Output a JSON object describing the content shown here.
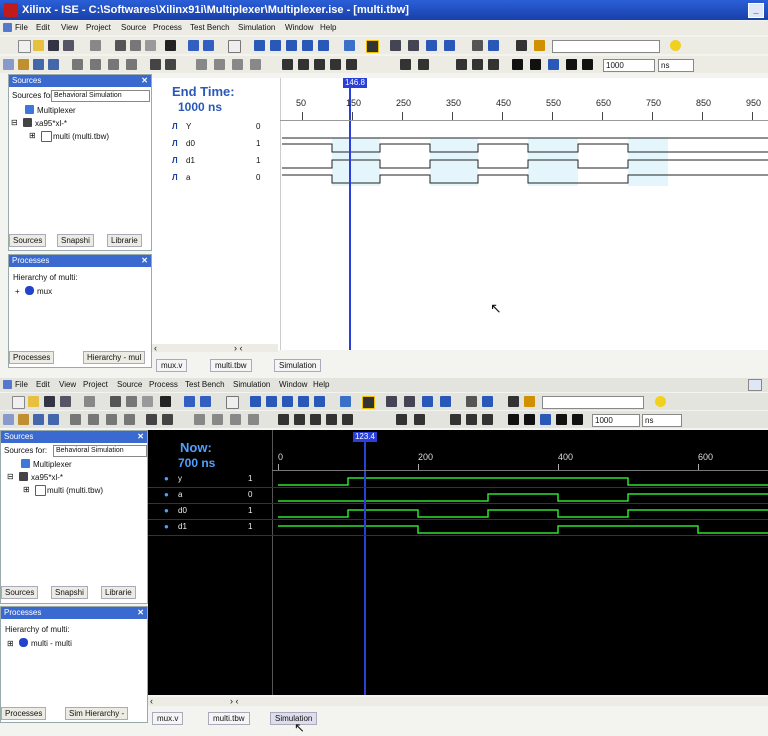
{
  "top_window": {
    "title": "Xilinx - ISE - C:\\Softwares\\Xilinx91i\\Multiplexer\\Multiplexer.ise - [multi.tbw]",
    "menu": [
      "File",
      "Edit",
      "View",
      "Project",
      "Source",
      "Process",
      "Test Bench",
      "Simulation",
      "Window",
      "Help"
    ],
    "controls": {
      "min": "_",
      "max": "□"
    },
    "toolbar": {
      "time_value": "1000",
      "time_unit": "ns"
    },
    "sources_panel": {
      "title": "Sources",
      "sources_for_label": "Sources for:",
      "sources_for_value": "Behavioral Simulation",
      "items": [
        "Multiplexer",
        "xa95*xl-*",
        "multi (multi.tbw)"
      ],
      "tabs": [
        "Sources",
        "Snapshi",
        "Librarie"
      ]
    },
    "processes_panel": {
      "title": "Processes",
      "hierarchy_label": "Hierarchy of multi:",
      "items": [
        "mux"
      ],
      "tabs": [
        "Processes",
        "Hierarchy - mul"
      ]
    },
    "wave": {
      "end_time_label": "End Time:",
      "end_time_value": "1000 ns",
      "cursor_value": "146.8",
      "axis_ticks": [
        "50",
        "150",
        "250",
        "350",
        "450",
        "550",
        "650",
        "750",
        "850",
        "950"
      ],
      "signals": [
        {
          "name": "Y",
          "value": "0"
        },
        {
          "name": "d0",
          "value": "1"
        },
        {
          "name": "d1",
          "value": "1"
        },
        {
          "name": "a",
          "value": "0"
        }
      ]
    },
    "file_tabs": [
      "mux.v",
      "multi.tbw",
      "Simulation"
    ]
  },
  "bottom_window": {
    "menu": [
      "File",
      "Edit",
      "View",
      "Project",
      "Source",
      "Process",
      "Test Bench",
      "Simulation",
      "Window",
      "Help"
    ],
    "toolbar": {
      "time_value": "1000",
      "time_unit": "ns"
    },
    "sources_panel": {
      "title": "Sources",
      "sources_for_label": "Sources for:",
      "sources_for_value": "Behavioral Simulation",
      "items": [
        "Multiplexer",
        "xa95*xl-*",
        "multi (multi.tbw)"
      ],
      "tabs": [
        "Sources",
        "Snapshi",
        "Librarie"
      ]
    },
    "processes_panel": {
      "title": "Processes",
      "hierarchy_label": "Hierarchy of multi:",
      "items": [
        "multi - multi"
      ],
      "tabs": [
        "Processes",
        "Sim Hierarchy -"
      ]
    },
    "wave": {
      "now_label": "Now:",
      "now_value": "700 ns",
      "cursor_value": "123.4",
      "axis_ticks": [
        "0",
        "200",
        "400",
        "600"
      ],
      "signals": [
        {
          "name": "y",
          "value": "1"
        },
        {
          "name": "a",
          "value": "0"
        },
        {
          "name": "d0",
          "value": "1"
        },
        {
          "name": "d1",
          "value": "1"
        }
      ]
    },
    "file_tabs": [
      "mux.v",
      "multi.tbw",
      "Simulation"
    ]
  },
  "colors": {
    "title_bar": "#1f4fc4",
    "panel_header": "#3a6ad0",
    "wave_green": "#2ee02e",
    "cursor_blue": "#2a3fd8"
  }
}
